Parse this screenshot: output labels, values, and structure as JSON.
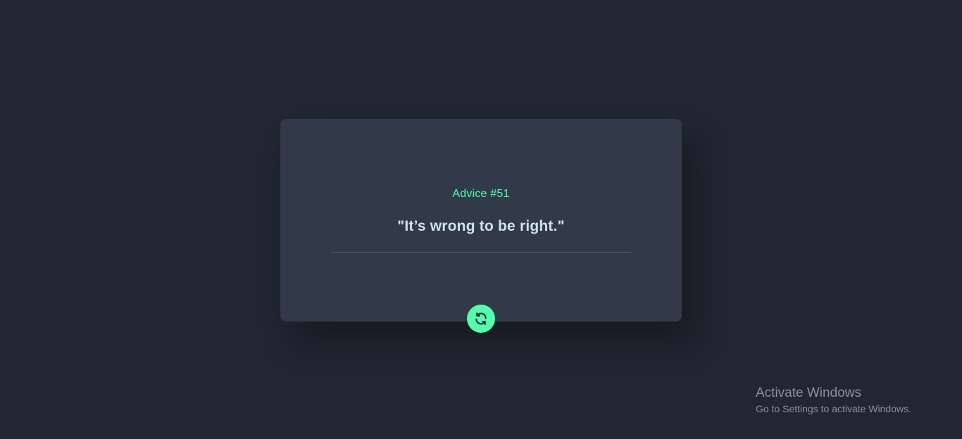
{
  "advice": {
    "label": "Advice #51",
    "quote": "\"It’s wrong to be right.\""
  },
  "button": {
    "icon": "refresh-icon",
    "aria_label": "Get new advice"
  },
  "watermark": {
    "title": "Activate Windows",
    "subtitle": "Go to Settings to activate Windows."
  },
  "colors": {
    "background": "#202632",
    "card": "#323a49",
    "accent": "#53ffaa",
    "quote_text": "#cee3e9",
    "divider": "#4f5d74"
  }
}
